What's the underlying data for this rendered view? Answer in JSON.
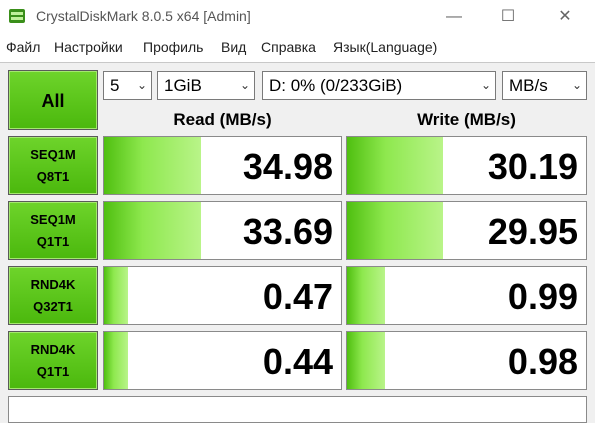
{
  "window": {
    "title": "CrystalDiskMark 8.0.5 x64 [Admin]",
    "minimize_glyph": "—",
    "maximize_glyph": "☐",
    "close_glyph": "✕"
  },
  "menu": [
    "Файл",
    "Настройки",
    "Профиль",
    "Вид",
    "Справка",
    "Язык(Language)"
  ],
  "controls": {
    "all_label": "All",
    "count": "5",
    "size": "1GiB",
    "drive": "D: 0% (0/233GiB)",
    "unit": "MB/s"
  },
  "headers": {
    "read": "Read (MB/s)",
    "write": "Write (MB/s)"
  },
  "tests": [
    {
      "line1": "SEQ1M",
      "line2": "Q8T1",
      "read": "34.98",
      "write": "30.19",
      "read_level": 0.41,
      "write_level": 0.4
    },
    {
      "line1": "SEQ1M",
      "line2": "Q1T1",
      "read": "33.69",
      "write": "29.95",
      "read_level": 0.41,
      "write_level": 0.4
    },
    {
      "line1": "RND4K",
      "line2": "Q32T1",
      "read": "0.47",
      "write": "0.99",
      "read_level": 0.1,
      "write_level": 0.16
    },
    {
      "line1": "RND4K",
      "line2": "Q1T1",
      "read": "0.44",
      "write": "0.98",
      "read_level": 0.1,
      "write_level": 0.16
    }
  ],
  "colors": {
    "accent_green": "#4fbf10",
    "button_green": "#5cc81c"
  },
  "icons": {
    "app": "crystaldiskmark-icon",
    "dropdown": "chevron-down-icon"
  }
}
